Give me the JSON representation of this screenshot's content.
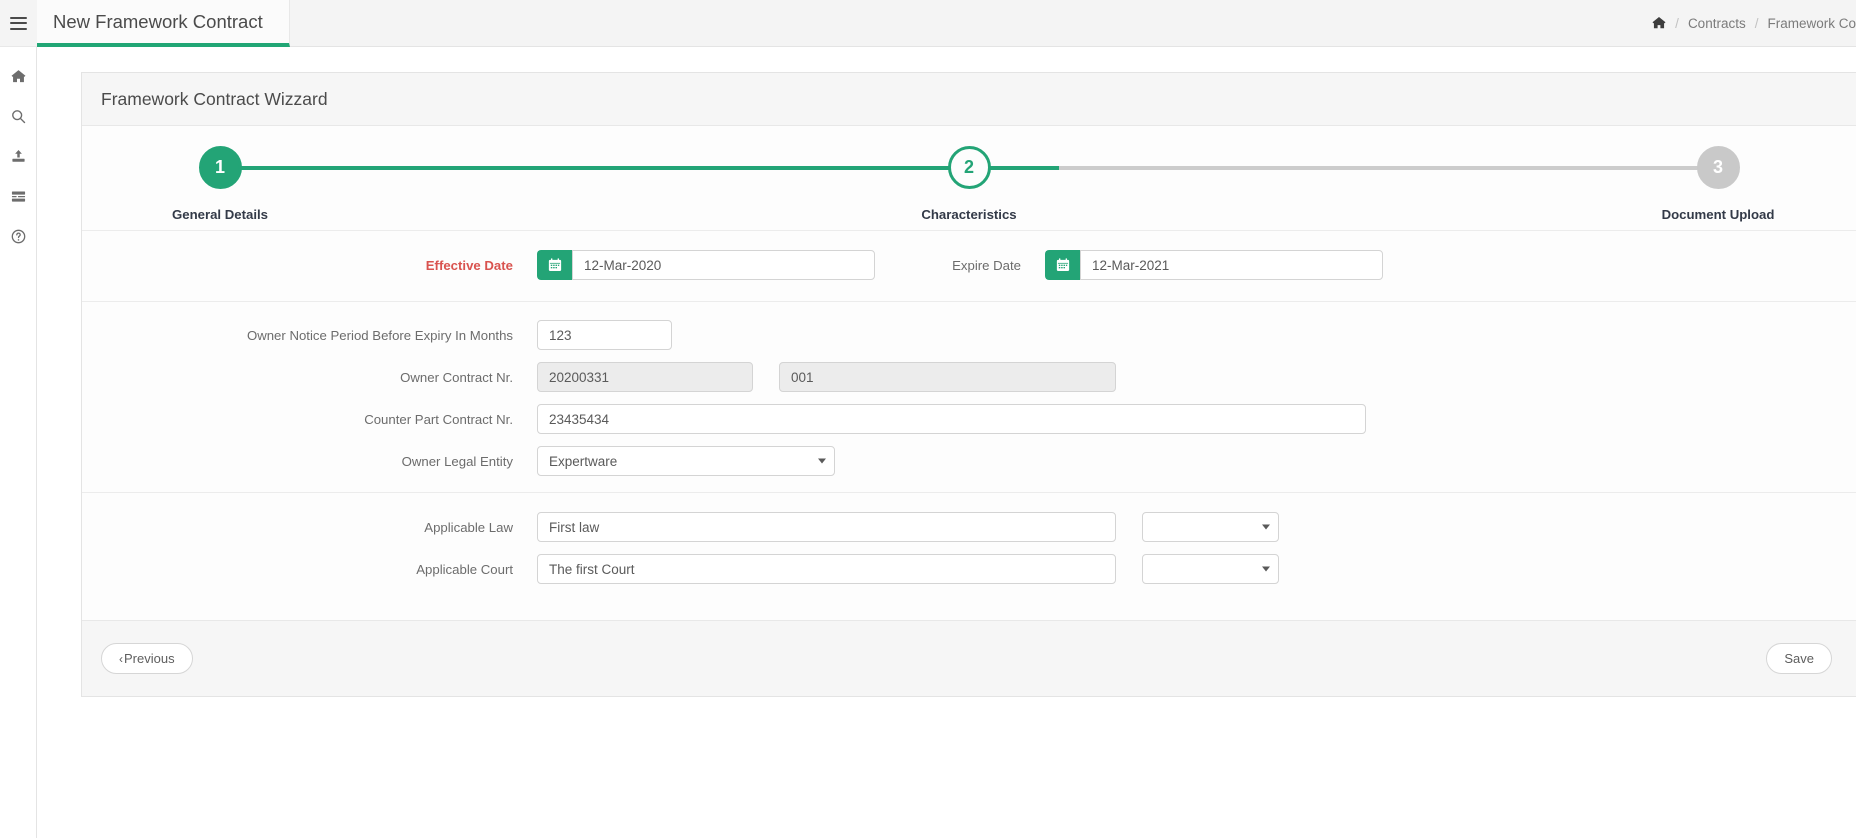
{
  "sidebar": {
    "menu_toggle": "menu-toggle",
    "items": [
      {
        "name": "home",
        "icon": "home-icon"
      },
      {
        "name": "search",
        "icon": "search-icon"
      },
      {
        "name": "upload",
        "icon": "upload-icon"
      },
      {
        "name": "list",
        "icon": "list-icon"
      },
      {
        "name": "help",
        "icon": "help-circle-icon"
      }
    ]
  },
  "header": {
    "tab_title": "New Framework Contract",
    "breadcrumb": {
      "home_icon": "home-icon",
      "separator": "/",
      "items": [
        "Contracts",
        "Framework Co"
      ]
    }
  },
  "card": {
    "title": "Framework Contract Wizzard"
  },
  "stepper": {
    "steps": [
      {
        "number": "1",
        "label": "General Details",
        "state": "done"
      },
      {
        "number": "2",
        "label": "Characteristics",
        "state": "active"
      },
      {
        "number": "3",
        "label": "Document Upload",
        "state": "todo"
      }
    ],
    "colors": {
      "active": "#23a476",
      "inactive": "#c9c9c9"
    }
  },
  "form": {
    "effective_date": {
      "label": "Effective Date",
      "required": true,
      "value": "12-Mar-2020",
      "icon": "calendar-icon"
    },
    "expire_date": {
      "label": "Expire Date",
      "required": false,
      "value": "12-Mar-2021",
      "icon": "calendar-icon"
    },
    "owner_notice_period": {
      "label": "Owner Notice Period Before Expiry In Months",
      "value": "123"
    },
    "owner_contract_nr": {
      "label": "Owner Contract Nr.",
      "value_primary": "20200331",
      "value_secondary": "001"
    },
    "counter_part_contract_nr": {
      "label": "Counter Part Contract Nr.",
      "value": "23435434"
    },
    "owner_legal_entity": {
      "label": "Owner Legal Entity",
      "value": "Expertware",
      "options": [
        "Expertware"
      ]
    },
    "applicable_law": {
      "label": "Applicable Law",
      "value": "First law",
      "select_value": "",
      "options": [
        ""
      ]
    },
    "applicable_court": {
      "label": "Applicable Court",
      "value": "The first Court",
      "select_value": "",
      "options": [
        ""
      ]
    }
  },
  "footer": {
    "previous_label": "Previous",
    "previous_chevron": "‹",
    "save_label": "Save"
  }
}
